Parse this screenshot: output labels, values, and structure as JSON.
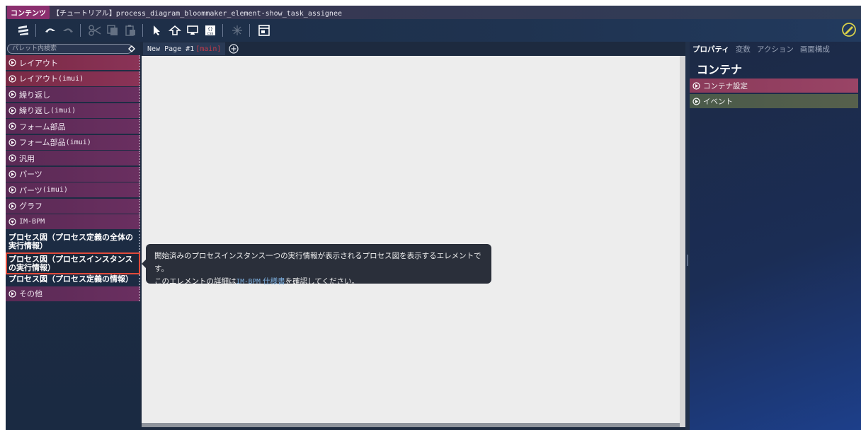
{
  "titlebar": {
    "badge": "コンテンツ",
    "title": "【チュートリアル】process_diagram_bloommaker_element-show_task_assignee"
  },
  "toolbar": {
    "icons": [
      "stack-icon",
      "undo-icon",
      "redo-icon",
      "cut-icon",
      "copy-icon",
      "paste-icon",
      "pointer-icon",
      "drag-icon",
      "preview-icon",
      "css-icon",
      "sparkle-icon",
      "layout-icon",
      "edit-icon"
    ]
  },
  "sidebar": {
    "search": {
      "placeholder": "パレット内検索"
    },
    "categories": [
      {
        "label": "レイアウト",
        "tag": ""
      },
      {
        "label": "レイアウト ",
        "tag": "(imui)"
      },
      {
        "label": "繰り返し",
        "tag": ""
      },
      {
        "label": "繰り返し ",
        "tag": "(imui)"
      },
      {
        "label": "フォーム部品",
        "tag": ""
      },
      {
        "label": "フォーム部品 ",
        "tag": "(imui)"
      },
      {
        "label": "汎用",
        "tag": ""
      },
      {
        "label": "パーツ",
        "tag": ""
      },
      {
        "label": "パーツ ",
        "tag": "(imui)"
      },
      {
        "label": "グラフ",
        "tag": ""
      },
      {
        "label": "",
        "tag": "IM-BPM"
      }
    ],
    "elements": [
      {
        "label": "プロセス図（プロセス定義の全体の実行情報）"
      },
      {
        "label": "プロセス図（プロセスインスタンスの実行情報）"
      },
      {
        "label": "プロセス図（プロセス定義の情報）"
      }
    ],
    "other": {
      "label": "その他"
    }
  },
  "canvas": {
    "tab_label": "New Page #1",
    "tab_tag": "[main]"
  },
  "tooltip": {
    "line1": "開始済みのプロセスインスタンス一つの実行情報が表示されるプロセス図を表示するエレメントです。",
    "line2_pre": "このエレメントの詳細は",
    "line2_code": "IM-BPM",
    "line2_link": " 仕様書",
    "line2_post": "を確認してください。"
  },
  "rpanel": {
    "tabs": [
      "プロパティ",
      "変数",
      "アクション",
      "画面構成"
    ],
    "title": "コンテナ",
    "sections": [
      "コンテナ設定",
      "イベント"
    ]
  },
  "colors": {
    "accent_red_outline": "#e04a3a",
    "category_red": "#8a3357",
    "category_purple": "#6a2f60",
    "badge": "#8b2f6e"
  }
}
